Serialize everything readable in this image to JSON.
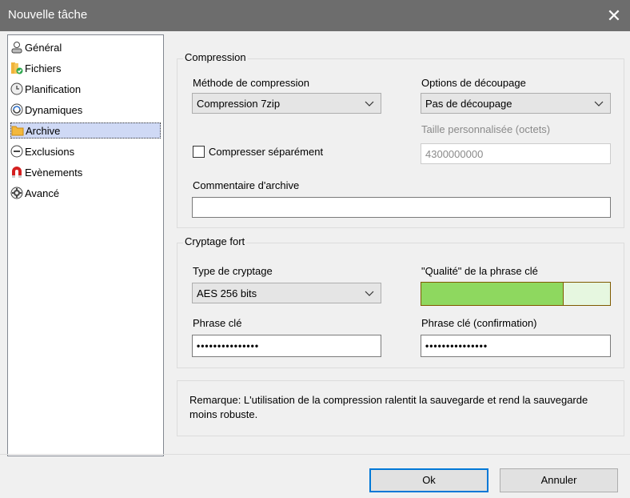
{
  "window": {
    "title": "Nouvelle tâche",
    "close_glyph": "✕"
  },
  "sidebar": {
    "items": [
      {
        "label": "Général",
        "icon": "general-icon"
      },
      {
        "label": "Fichiers",
        "icon": "files-icon"
      },
      {
        "label": "Planification",
        "icon": "clock-icon"
      },
      {
        "label": "Dynamiques",
        "icon": "dynamic-icon"
      },
      {
        "label": "Archive",
        "icon": "folder-icon",
        "selected": true
      },
      {
        "label": "Exclusions",
        "icon": "minus-icon"
      },
      {
        "label": "Evènements",
        "icon": "magnet-icon"
      },
      {
        "label": "Avancé",
        "icon": "gear-icon"
      }
    ]
  },
  "compression": {
    "group_title": "Compression",
    "method_label": "Méthode de compression",
    "method_value": "Compression 7zip",
    "split_label": "Options de découpage",
    "split_value": "Pas de découpage",
    "custom_size_label": "Taille personnalisée (octets)",
    "custom_size_value": "4300000000",
    "separate_label": "Compresser séparément",
    "separate_checked": false,
    "comment_label": "Commentaire d'archive",
    "comment_value": ""
  },
  "encryption": {
    "group_title": "Cryptage fort",
    "type_label": "Type de cryptage",
    "type_value": "AES 256 bits",
    "quality_label": "\"Qualité\" de la phrase clé",
    "quality_fraction": 0.75,
    "passphrase_label": "Phrase clé",
    "passphrase_value": "•••••••••••••••",
    "confirm_label": "Phrase clé (confirmation)",
    "confirm_value": "•••••••••••••••"
  },
  "note": {
    "text": "Remarque: L'utilisation de la compression ralentit la sauvegarde et rend la sauvegarde moins robuste."
  },
  "buttons": {
    "ok": "Ok",
    "cancel": "Annuler"
  },
  "colors": {
    "titlebar": "#6d6d6d",
    "accent": "#0078d7",
    "meter_fill": "#8ed85f"
  }
}
